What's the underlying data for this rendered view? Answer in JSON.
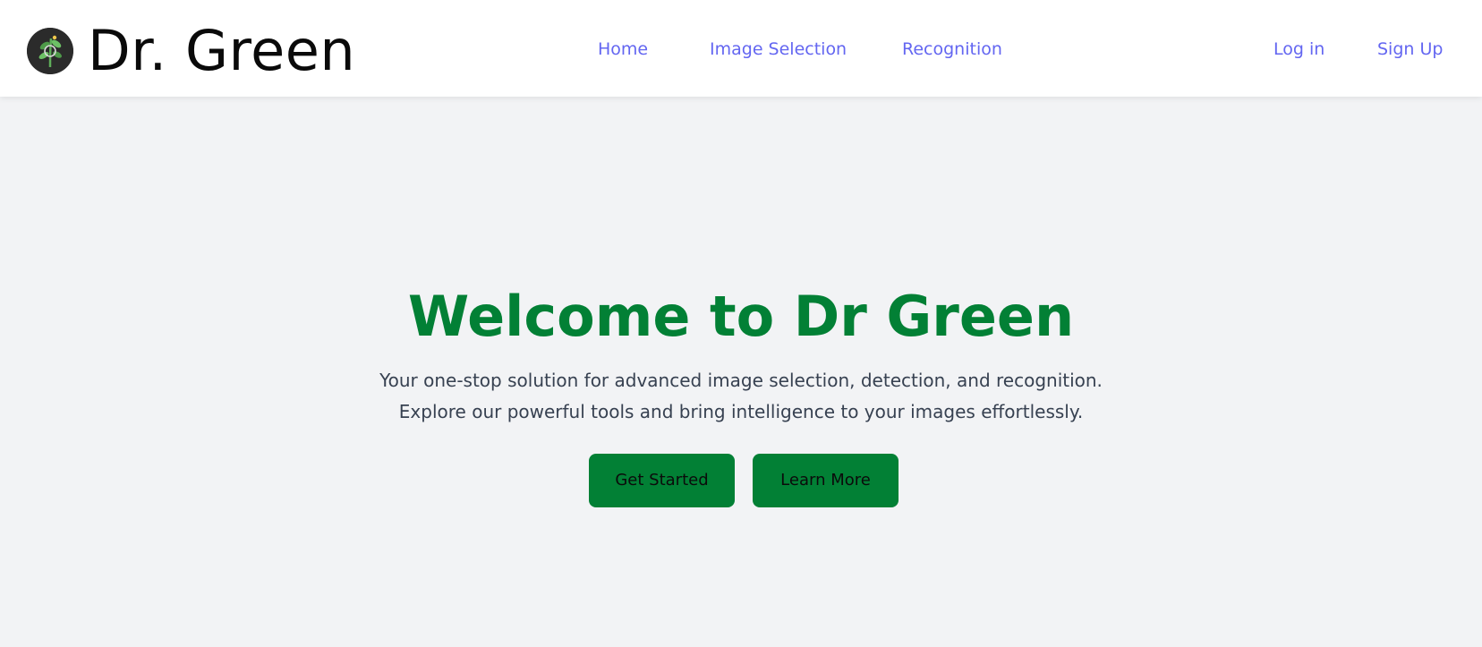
{
  "brand": {
    "name": "Dr. Green",
    "logo_icon": "plant-leaf-icon"
  },
  "nav": {
    "links": [
      {
        "label": "Home"
      },
      {
        "label": "Image Selection"
      },
      {
        "label": "Recognition"
      }
    ],
    "auth": [
      {
        "label": "Log in"
      },
      {
        "label": "Sign Up"
      }
    ]
  },
  "hero": {
    "title": "Welcome to Dr Green",
    "subtitle_line1": "Your one-stop solution for advanced image selection, detection, and recognition.",
    "subtitle_line2": "Explore our powerful tools and bring intelligence to your images effortlessly.",
    "primary_button": "Get Started",
    "secondary_button": "Learn More"
  },
  "colors": {
    "accent_green": "#028035",
    "nav_link": "#6366f1",
    "background": "#f2f3f5"
  }
}
